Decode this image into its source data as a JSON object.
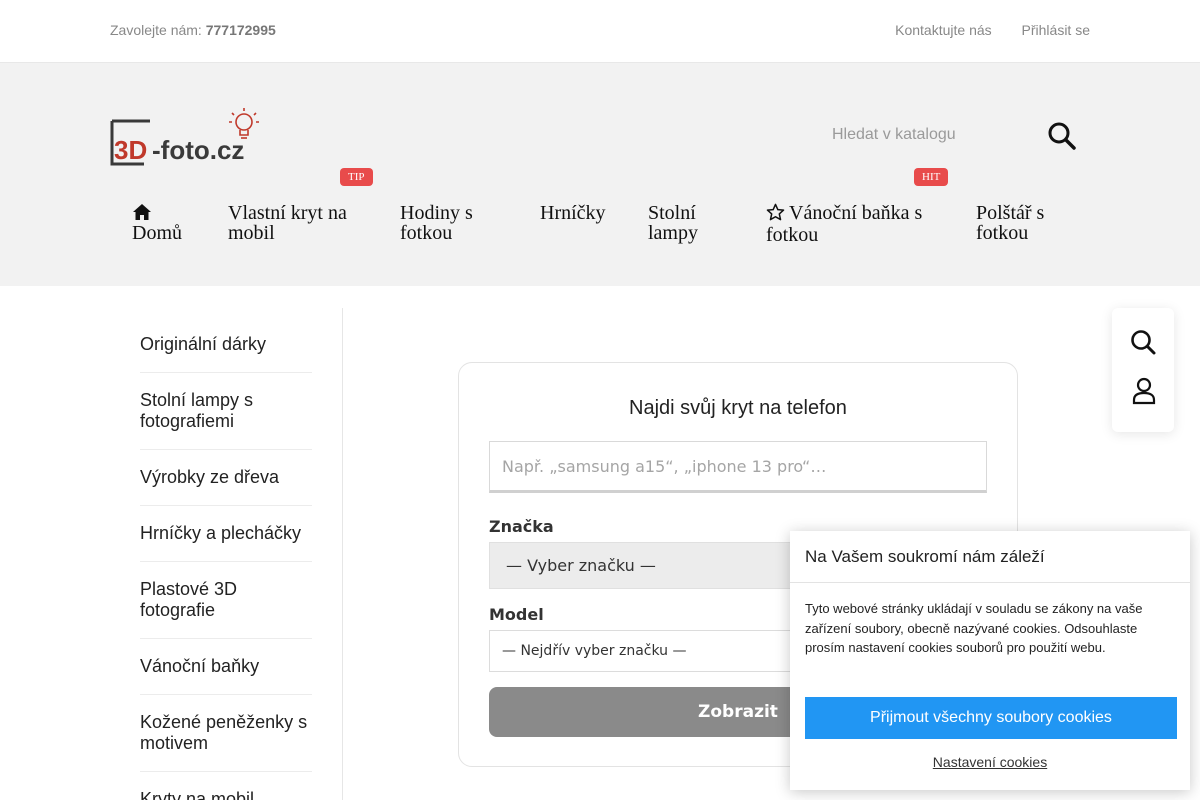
{
  "topbar": {
    "call_label": "Zavolejte nám: ",
    "phone": "777172995",
    "contact": "Kontaktujte nás",
    "login": "Přihlásit se"
  },
  "header": {
    "logo_text": "3D-foto.cz",
    "search_placeholder": "Hledat v katalogu",
    "search_icon": "search-icon"
  },
  "nav": {
    "items": [
      {
        "label": "Domů",
        "icon": "home-icon"
      },
      {
        "label": "Vlastní kryt na mobil",
        "badge": "TIP"
      },
      {
        "label": "Hodiny s fotkou"
      },
      {
        "label": "Hrníčky"
      },
      {
        "label": "Stolní lampy"
      },
      {
        "label": "Vánoční baňka s fotkou",
        "icon": "star-icon",
        "badge": "HIT"
      },
      {
        "label": "Polštář s fotkou"
      }
    ]
  },
  "sidebar": {
    "items": [
      {
        "label": "Originální dárky"
      },
      {
        "label": "Stolní lampy s fotografiemi"
      },
      {
        "label": "Výrobky ze dřeva"
      },
      {
        "label": "Hrníčky a plecháčky"
      },
      {
        "label": "Plastové 3D fotografie"
      },
      {
        "label": "Vánoční baňky"
      },
      {
        "label": "Kožené peněženky s motivem"
      },
      {
        "label": "Kryty na mobil",
        "expandable": true
      }
    ]
  },
  "finder": {
    "title": "Najdi svůj kryt na telefon",
    "search_placeholder": "Např. „samsung a15“, „iphone 13 pro“…",
    "brand_label": "Značka",
    "brand_value": "— Vyber značku —",
    "model_label": "Model",
    "model_value": "— Nejdřív vyber značku —",
    "submit_label": "Zobrazit"
  },
  "cookie": {
    "title": "Na Vašem soukromí nám záleží",
    "text": "Tyto webové stránky ukládají v souladu se zákony na vaše zařízení soubory, obecně nazývané cookies. Odsouhlaste prosím nastavení cookies souborů pro použití webu.",
    "accept_label": "Přijmout všechny soubory cookies",
    "settings_label": "Nastavení cookies"
  },
  "colors": {
    "accent_blue": "#2196f3",
    "badge_red": "#e84b4b",
    "logo_red": "#c0392b",
    "logo_dark": "#3a3a3a",
    "header_bg": "#f2f2f2"
  }
}
